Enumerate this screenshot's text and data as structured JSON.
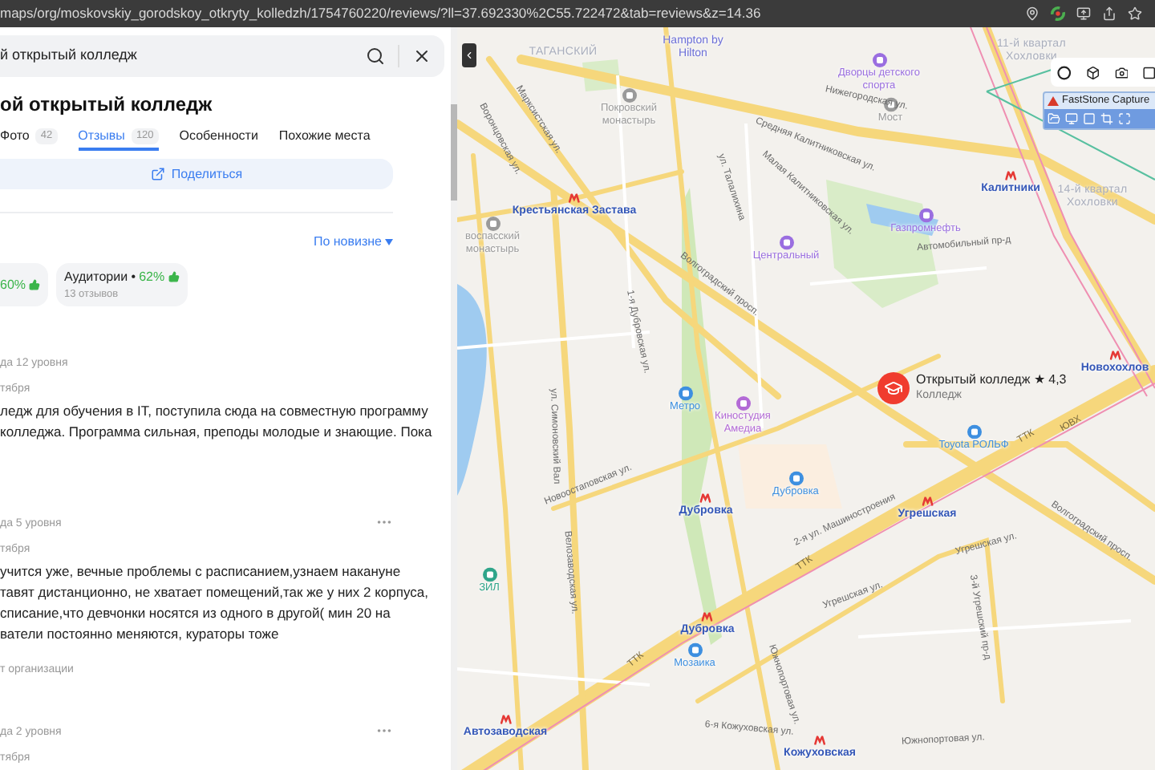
{
  "browser": {
    "url": "maps/org/moskovskiy_gorodskoy_otkryty_kolledzh/1754760220/reviews/?ll=37.692330%2C55.722472&tab=reviews&z=14.36"
  },
  "search": {
    "value": "й открытый колледж"
  },
  "place": {
    "title": "ой открытый колледж"
  },
  "tabs": [
    {
      "label": "Фото",
      "count": "42",
      "selected": false
    },
    {
      "label": "Отзывы",
      "count": "120",
      "selected": true
    },
    {
      "label": "Особенности",
      "selected": false
    },
    {
      "label": "Похожие места",
      "selected": false
    }
  ],
  "share_button": "Поделиться",
  "sort": "По новизне",
  "aspects": [
    {
      "percent": "60%"
    },
    {
      "name": "Аудитории •",
      "percent": "62%",
      "sub": "13 отзывов"
    }
  ],
  "reviews": [
    {
      "level": "да 12 уровня",
      "date": "тября",
      "menu": false,
      "lines": [
        "ледж для обучения в IT, поступила сюда на совместную программу",
        "колледжа. Программа сильная, преподы молодые и знающие. Пока"
      ]
    },
    {
      "level": "да 5 уровня",
      "date": "тября",
      "menu": true,
      "lines": [
        "учится уже, вечные проблемы с расписанием,узнаем накануне",
        "тавят дистанционно, не хватает помещений,так же у них 2 корпуса,",
        "списание,что девчонки носятся из одного в другой( мин 20 на",
        "ватели постоянно меняются, кураторы тоже"
      ],
      "reply": "т организации"
    },
    {
      "level": "да 2 уровня",
      "date": "тября",
      "menu": true
    }
  ],
  "map": {
    "pin": {
      "title": "Открытый колледж ★ 4,3",
      "category": "Колледж"
    },
    "toolbar_title": "FastStone Capture",
    "labels": [
      {
        "text": "ТАГАНСКИЙ",
        "kind": "district"
      },
      {
        "text": "Hampton by Hilton",
        "kind": "place",
        "color": "#6c6fd8"
      },
      {
        "text": "Покровский монастырь",
        "kind": "poi",
        "color": "#9a9a9a"
      },
      {
        "text": "Дворцы детского спорта",
        "kind": "poi",
        "color": "#9a6ee0"
      },
      {
        "text": "Мост",
        "kind": "poi",
        "color": "#9a9a9a"
      },
      {
        "text": "Нижегородская ул.",
        "kind": "street"
      },
      {
        "text": "Марксистская ул.",
        "kind": "street"
      },
      {
        "text": "Воронцовская ул.",
        "kind": "street"
      },
      {
        "text": "Средняя Калитниковская ул.",
        "kind": "street"
      },
      {
        "text": "Малая Калитниковская ул.",
        "kind": "street"
      },
      {
        "text": "ул. Талалихина",
        "kind": "street"
      },
      {
        "text": "Крестьянская Застава",
        "kind": "metro"
      },
      {
        "text": "воспасский монастырь",
        "kind": "poi",
        "color": "#9a9a9a"
      },
      {
        "text": "Калитники",
        "kind": "metro"
      },
      {
        "text": "11-й квартал Хохловки",
        "kind": "district"
      },
      {
        "text": "14-й квартал Хохловки",
        "kind": "district"
      },
      {
        "text": "Газпромнефть",
        "kind": "poi",
        "color": "#9a6ee0"
      },
      {
        "text": "Центральный",
        "kind": "poi",
        "color": "#9a6ee0"
      },
      {
        "text": "Автомобильный пр-д",
        "kind": "street"
      },
      {
        "text": "Волгоградский просп.",
        "kind": "street"
      },
      {
        "text": "1-я Дубровская ул.",
        "kind": "street"
      },
      {
        "text": "ул. Симоновский Вал",
        "kind": "street"
      },
      {
        "text": "Метро",
        "kind": "poi",
        "color": "#3d8fe0"
      },
      {
        "text": "Киностудия Амедиа",
        "kind": "poi",
        "color": "#b36ad6"
      },
      {
        "text": "Новоостаповская ул.",
        "kind": "street"
      },
      {
        "text": "Дубровка",
        "kind": "poi",
        "color": "#3d8fe0"
      },
      {
        "text": "Дубровка",
        "kind": "metro"
      },
      {
        "text": "Toyota РОЛЬФ",
        "kind": "poi",
        "color": "#3d8fe0"
      },
      {
        "text": "2-я ул. Машиностроения",
        "kind": "street"
      },
      {
        "text": "Угрешская",
        "kind": "metro"
      },
      {
        "text": "Угрешская ул.",
        "kind": "street"
      },
      {
        "text": "Угрешская ул.",
        "kind": "street"
      },
      {
        "text": "3-й Угрешский пр-д",
        "kind": "street"
      },
      {
        "text": "Волгоградский просп.",
        "kind": "street"
      },
      {
        "text": "Велозаводская ул.",
        "kind": "street"
      },
      {
        "text": "ЗИЛ",
        "kind": "poi",
        "color": "#2fa58a"
      },
      {
        "text": "Дубровка",
        "kind": "metro"
      },
      {
        "text": "Мозаика",
        "kind": "poi",
        "color": "#3d8fe0"
      },
      {
        "text": "Автозаводская",
        "kind": "metro"
      },
      {
        "text": "Южнопортовая ул.",
        "kind": "street"
      },
      {
        "text": "6-я Кожуховская ул.",
        "kind": "street"
      },
      {
        "text": "Кожуховская",
        "kind": "metro"
      },
      {
        "text": "Южнопортовая ул.",
        "kind": "street"
      },
      {
        "text": "ТТК",
        "kind": "road"
      },
      {
        "text": "ТТК",
        "kind": "road"
      },
      {
        "text": "ЮВХ",
        "kind": "road"
      },
      {
        "text": "ТТК",
        "kind": "road"
      },
      {
        "text": "Новохохлов",
        "kind": "metro"
      }
    ]
  }
}
